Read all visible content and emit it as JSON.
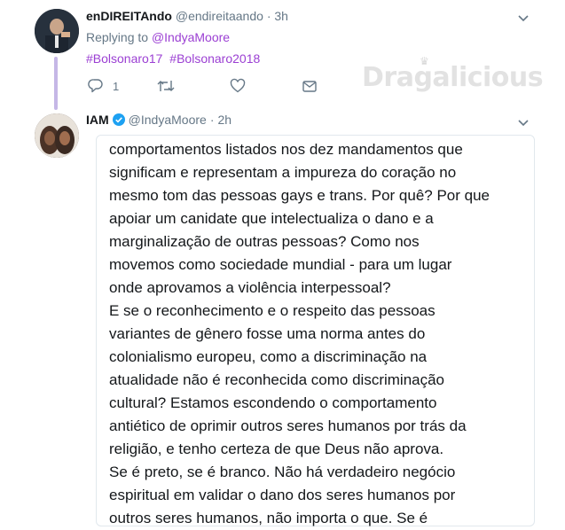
{
  "tweet1": {
    "display_name": "enDIREITAndo",
    "handle": "@endireitaando",
    "time": "3h",
    "replying_prefix": "Replying to",
    "replying_to": "@IndyaMoore",
    "hashtags": [
      "#Bolsonaro17",
      "#Bolsonaro2018"
    ],
    "reply_count": "1",
    "icons": [
      "reply-icon",
      "retweet-icon",
      "like-icon",
      "dm-icon",
      "chevron-down-icon"
    ]
  },
  "watermark": "Dragalicious",
  "tweet2": {
    "display_name": "IAM",
    "handle": "@IndyaMoore",
    "time": "2h",
    "text_lines": [
      "comportamentos listados nos dez mandamentos que",
      "significam e representam a impureza do coração no",
      "mesmo tom das pessoas gays e trans. Por quê? Por que",
      "apoiar um canidate que intelectualiza o dano e a",
      "marginalização de outras pessoas? Como nos",
      "movemos como sociedade mundial - para um lugar",
      "onde aprovamos a violência interpessoal?",
      "E se o reconhecimento e o respeito das pessoas",
      "variantes de gênero fosse uma norma antes do",
      "colonialismo europeu, como a discriminação na",
      "atualidade não é reconhecida como discriminação",
      "cultural? Estamos escondendo o comportamento",
      "antiético de oprimir outros seres humanos por trás da",
      "religião, e tenho certeza de que Deus não aprova.",
      "Se é preto, se é branco. Não há verdadeiro negócio",
      "espiritual em validar o dano dos seres humanos por",
      "outros seres humanos, não importa o que. Se é"
    ]
  },
  "colors": {
    "link": "#9b3fd3",
    "muted": "#657786",
    "thread_line": "#c5b7e6",
    "verified": "#1da1f2"
  }
}
